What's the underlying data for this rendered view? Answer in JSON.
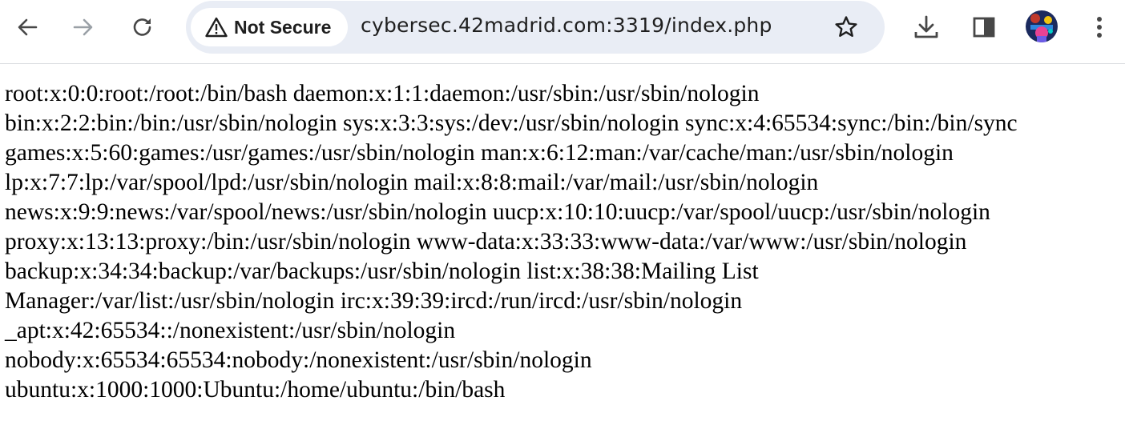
{
  "browser": {
    "toolbar": {
      "back_icon": "arrow-left-icon",
      "forward_icon": "arrow-right-icon",
      "reload_icon": "reload-icon",
      "download_icon": "download-icon",
      "side_panel_icon": "side-panel-icon",
      "menu_icon": "kebab-menu-icon"
    },
    "omnibox": {
      "security_label": "Not Secure",
      "security_icon": "warning-triangle-icon",
      "url": "cybersec.42madrid.com:3319/index.php",
      "bookmark_icon": "star-icon"
    },
    "colors": {
      "omnibox_bg": "#e9edf5",
      "icon": "#474747",
      "forward_disabled": "#9aa0a6"
    }
  },
  "page": {
    "lines": [
      "root:x:0:0:root:/root:/bin/bash daemon:x:1:1:daemon:/usr/sbin:/usr/sbin/nologin",
      "bin:x:2:2:bin:/bin:/usr/sbin/nologin sys:x:3:3:sys:/dev:/usr/sbin/nologin sync:x:4:65534:sync:/bin:/bin/sync",
      "games:x:5:60:games:/usr/games:/usr/sbin/nologin man:x:6:12:man:/var/cache/man:/usr/sbin/nologin",
      "lp:x:7:7:lp:/var/spool/lpd:/usr/sbin/nologin mail:x:8:8:mail:/var/mail:/usr/sbin/nologin",
      "news:x:9:9:news:/var/spool/news:/usr/sbin/nologin uucp:x:10:10:uucp:/var/spool/uucp:/usr/sbin/nologin",
      "proxy:x:13:13:proxy:/bin:/usr/sbin/nologin www-data:x:33:33:www-data:/var/www:/usr/sbin/nologin",
      "backup:x:34:34:backup:/var/backups:/usr/sbin/nologin list:x:38:38:Mailing List",
      "Manager:/var/list:/usr/sbin/nologin irc:x:39:39:ircd:/run/ircd:/usr/sbin/nologin",
      "_apt:x:42:65534::/nonexistent:/usr/sbin/nologin",
      "nobody:x:65534:65534:nobody:/nonexistent:/usr/sbin/nologin",
      "ubuntu:x:1000:1000:Ubuntu:/home/ubuntu:/bin/bash"
    ]
  }
}
